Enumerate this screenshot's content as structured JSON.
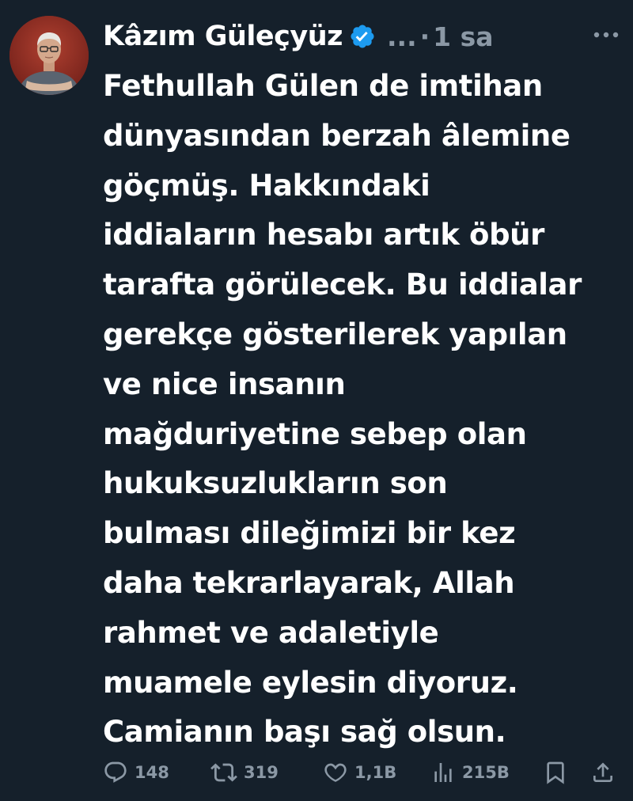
{
  "author": {
    "name": "Kâzım Güleçyüz",
    "handle": "...",
    "separator": "·",
    "time": "1 sa",
    "verified": true
  },
  "tweet": {
    "lines": [
      "Fethullah Gülen de imtihan",
      "dünyasından berzah âlemine",
      "göçmüş. Hakkındaki",
      "iddiaların hesabı artık öbür",
      "tarafta görülecek. Bu iddialar",
      "gerekçe gösterilerek yapılan",
      "ve nice insanın",
      "mağduriyetine sebep olan",
      "hukuksuzlukların son",
      "bulması dileğimizi bir kez",
      "daha tekrarlayarak, Allah",
      "rahmet ve adaletiyle",
      "muamele eylesin diyoruz.",
      "Camianın başı sağ olsun."
    ]
  },
  "actions": {
    "replies": "148",
    "retweets": "319",
    "likes": "1,1B",
    "views": "215B"
  },
  "icons": {
    "reply": "reply-icon",
    "retweet": "retweet-icon",
    "like": "heart-icon",
    "views": "views-icon",
    "bookmark": "bookmark-icon",
    "share": "share-icon",
    "more": "more-icon",
    "verified": "verified-badge-icon"
  },
  "colors": {
    "background": "#15202b",
    "text": "#ffffff",
    "secondary": "#8b98a5",
    "verified": "#1d9bf0"
  }
}
